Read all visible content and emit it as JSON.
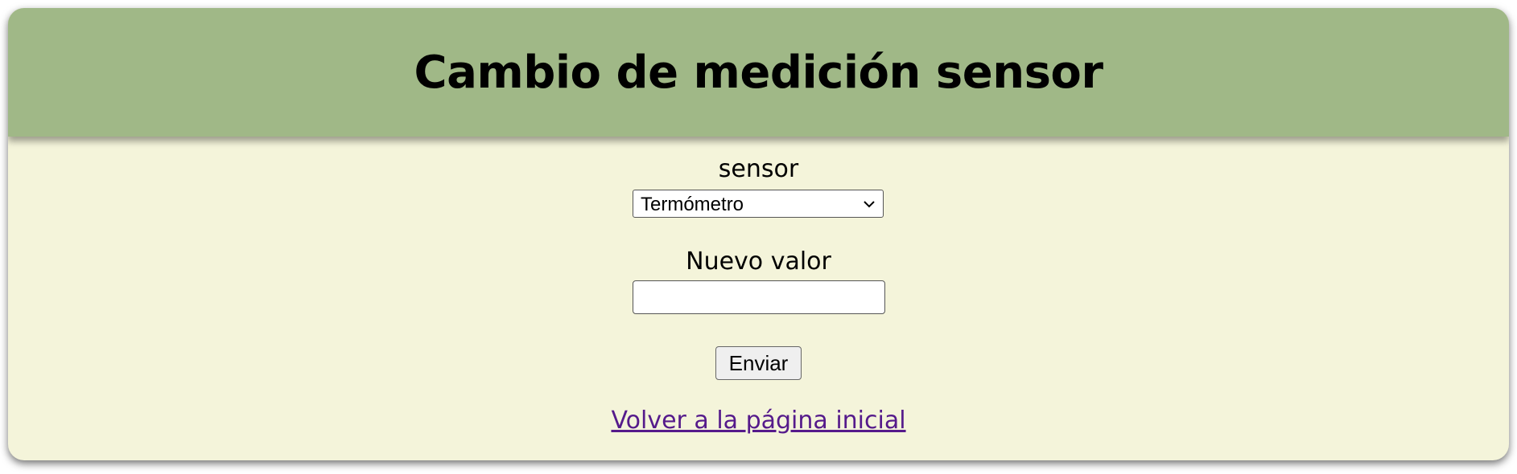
{
  "header": {
    "title": "Cambio de medición sensor"
  },
  "form": {
    "sensor_label": "sensor",
    "sensor_selected": "Termómetro",
    "value_label": "Nuevo valor",
    "value_current": "",
    "submit_label": "Enviar"
  },
  "footer": {
    "back_link": "Volver a la página inicial"
  },
  "colors": {
    "header_bg": "#a0b887",
    "card_bg": "#f4f4da",
    "link": "#551a8b"
  },
  "icons": {
    "select_arrow": "chevron-down-icon"
  }
}
